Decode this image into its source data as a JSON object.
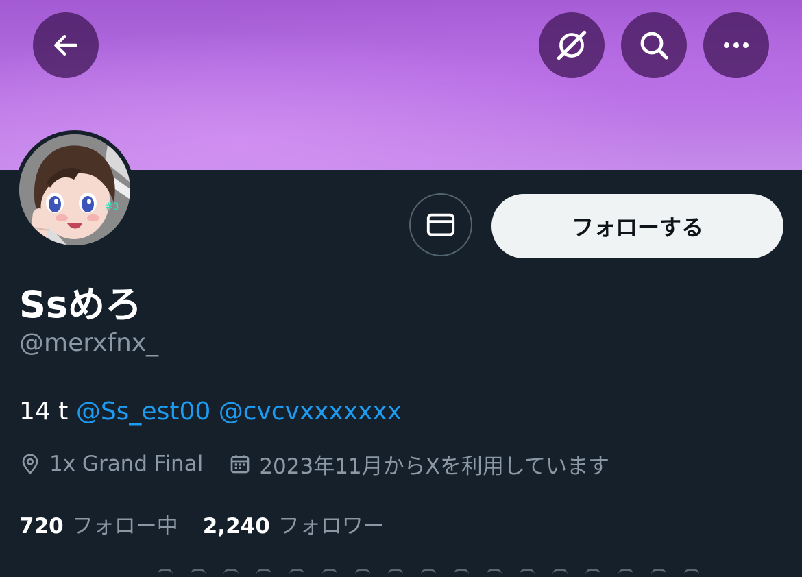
{
  "header": {
    "back_icon": "arrow-left-icon",
    "grok_icon": "grok-icon",
    "search_icon": "search-icon",
    "more_icon": "more-horizontal-icon",
    "banner_color": "#b06de0"
  },
  "profile": {
    "display_name": "Ssめろ",
    "handle": "@merxfnx_",
    "follow_label": "フォローする",
    "message_icon": "envelope-icon",
    "bio": {
      "prefix": "14 t",
      "mention1": "@Ss_est00",
      "mention2": "@cvcvxxxxxxx"
    },
    "location": "1x Grand Final",
    "location_icon": "location-pin-icon",
    "joined": "2023年11月からXを利用しています",
    "joined_icon": "calendar-icon",
    "following_count": "720",
    "following_label": "フォロー中",
    "followers_count": "2,240",
    "followers_label": "フォロワー"
  },
  "colors": {
    "background": "#15202b",
    "accent_link": "#1d9bf0",
    "secondary_text": "#8b98a5",
    "follow_button_bg": "#eff3f4"
  }
}
